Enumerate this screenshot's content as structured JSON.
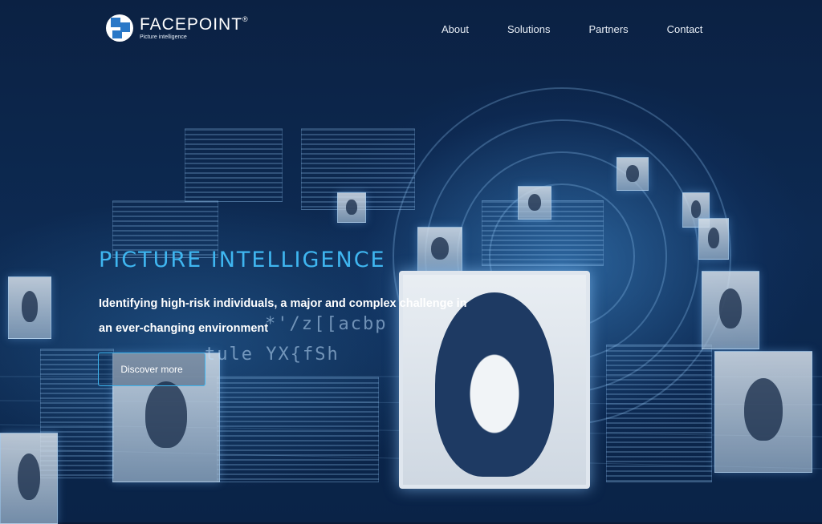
{
  "header": {
    "brand_name": "FACEPOINT",
    "brand_mark": "®",
    "tagline": "Picture intelligence",
    "nav": [
      {
        "label": "About"
      },
      {
        "label": "Solutions"
      },
      {
        "label": "Partners"
      },
      {
        "label": "Contact"
      }
    ]
  },
  "hero": {
    "title": "PICTURE INTELLIGENCE",
    "subtitle": "Identifying high-risk individuals, a major and complex challenge in an ever-changing environment",
    "cta_label": "Discover more"
  },
  "background_glyphs": [
    "*'/z[[acbp",
    "tule YX{fSh"
  ],
  "colors": {
    "accent": "#3fb6f0",
    "background": "#0a1a36",
    "logo_blue": "#2a78c7"
  },
  "icons": {
    "logo": "facepoint-logo-icon"
  }
}
